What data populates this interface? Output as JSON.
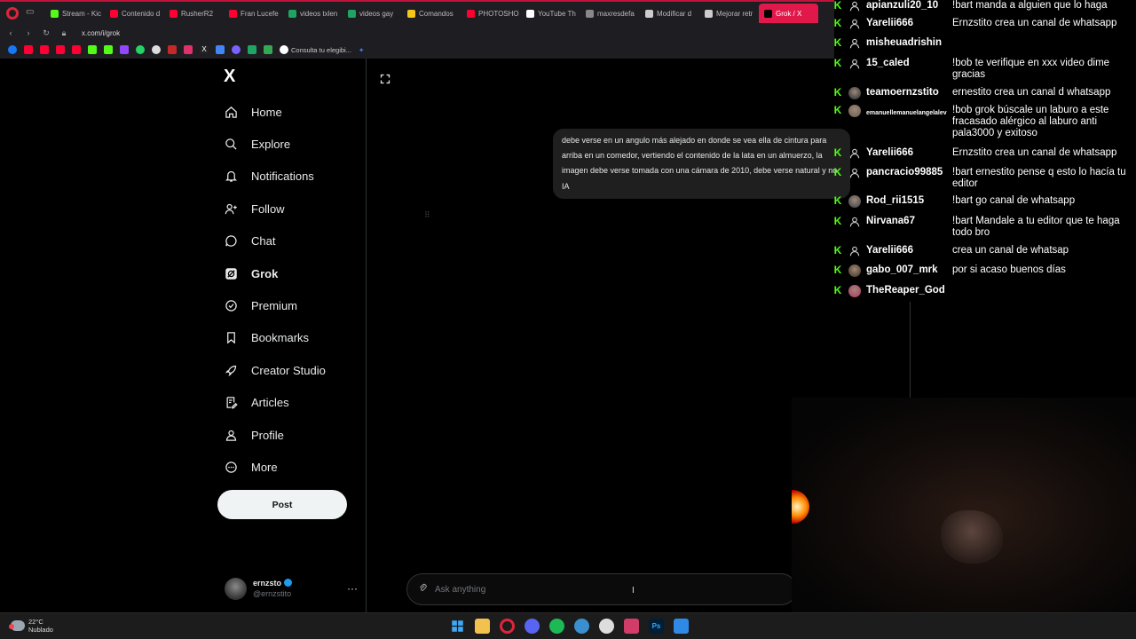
{
  "browser": {
    "tabs": [
      {
        "label": "Stream - Kic",
        "color": "#53fc18"
      },
      {
        "label": "Contenido d",
        "color": "#ff0033"
      },
      {
        "label": "RusherR2",
        "color": "#ff0033"
      },
      {
        "label": "Fran Lucefe",
        "color": "#ff0033"
      },
      {
        "label": "videos txlen",
        "color": "#1fa463"
      },
      {
        "label": "videos gay",
        "color": "#1fa463"
      },
      {
        "label": "Comandos",
        "color": "#f5c518"
      },
      {
        "label": "PHOTOSHO",
        "color": "#ff0033"
      },
      {
        "label": "YouTube Th",
        "color": "#ffffff"
      },
      {
        "label": "maxresdefa",
        "color": "#888888"
      },
      {
        "label": "Modificar d",
        "color": "#cccccc"
      },
      {
        "label": "Mejorar retr",
        "color": "#cccccc"
      },
      {
        "label": "Grok / X",
        "color": "#000000",
        "active": true
      }
    ],
    "url": "x.com/i/grok",
    "bookmark_text": "Consulta tu elegibi..."
  },
  "sidebar": {
    "logo": "X",
    "items": [
      {
        "label": "Home",
        "icon": "home-icon"
      },
      {
        "label": "Explore",
        "icon": "search-icon"
      },
      {
        "label": "Notifications",
        "icon": "bell-icon"
      },
      {
        "label": "Follow",
        "icon": "person-add-icon"
      },
      {
        "label": "Chat",
        "icon": "chat-icon"
      },
      {
        "label": "Grok",
        "icon": "grok-icon"
      },
      {
        "label": "Premium",
        "icon": "verified-icon"
      },
      {
        "label": "Bookmarks",
        "icon": "bookmark-icon"
      },
      {
        "label": "Creator Studio",
        "icon": "rocket-icon"
      },
      {
        "label": "Articles",
        "icon": "article-icon"
      },
      {
        "label": "Profile",
        "icon": "person-icon"
      },
      {
        "label": "More",
        "icon": "more-circle-icon"
      }
    ],
    "post_label": "Post",
    "user": {
      "name": "ernzsto",
      "handle": "@ernzstito"
    }
  },
  "grok": {
    "prompt": "debe verse en un angulo más alejado en donde se vea ella de cintura para arriba en un comedor, vertiendo el contenido de la lata en un almuerzo, la imagen debe verse tomada con una cámara de 2010, debe verse natural y no IA",
    "input_placeholder": "Ask anything"
  },
  "chat": [
    {
      "user": "apianzuli20_10",
      "message": "!bart manda a alguien que lo haga",
      "avatar": "none"
    },
    {
      "user": "Yarelii666",
      "message": "Ernzstito crea un canal de whatsapp",
      "avatar": "none"
    },
    {
      "user": "misheuadrishin",
      "message": "",
      "avatar": "none"
    },
    {
      "user": "15_caled",
      "message": "!bob te verifique en xxx video dime gracias",
      "avatar": "none"
    },
    {
      "user": "teamoernzstito",
      "message": "ernestito crea un canal d whatsapp",
      "avatar": "photo"
    },
    {
      "user": "emanuellemanuelangelalev",
      "message": "!bob grok búscale un laburo a este fracasado alérgico al laburo anti pala3000 y exitoso",
      "avatar": "photo",
      "small": true
    },
    {
      "user": "Yarelii666",
      "message": "Ernzstito crea un canal de whatsapp",
      "avatar": "none"
    },
    {
      "user": "pancracio99885",
      "message": "!bart ernestito pense q esto lo hacía tu editor",
      "avatar": "none"
    },
    {
      "user": "Rod_rii1515",
      "message": "!bart go canal de whatsapp",
      "avatar": "photo"
    },
    {
      "user": "Nirvana67",
      "message": "!bart Mandale a tu editor que te haga todo bro",
      "avatar": "none"
    },
    {
      "user": "Yarelii666",
      "message": "crea un canal de whatsap",
      "avatar": "none"
    },
    {
      "user": "gabo_007_mrk",
      "message": "por si acaso buenos días",
      "avatar": "photo"
    },
    {
      "user": "TheReaper_God",
      "message": "",
      "avatar": "photo"
    }
  ],
  "taskbar": {
    "temperature": "22°C",
    "condition": "Nublado",
    "ps_label": "Ps"
  }
}
